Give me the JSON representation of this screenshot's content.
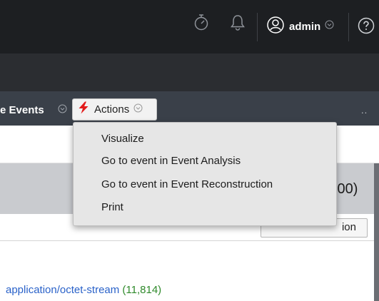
{
  "header": {
    "user_name": "admin",
    "icons": [
      "stopwatch-icon",
      "bell-icon",
      "user-icon",
      "chevron-down-icon",
      "help-icon"
    ]
  },
  "toolbar": {
    "title_fragment": "e Events",
    "actions_label": "Actions",
    "overflow": ".."
  },
  "actions_menu": {
    "items": [
      "Visualize",
      "Go to event in Event Analysis",
      "Go to event in Event Reconstruction",
      "Print"
    ]
  },
  "time_range_suffix": ":00)",
  "visualization_button": "ion",
  "content": {
    "mime_type": "application/octet-stream",
    "count": "(11,814)"
  },
  "colors": {
    "topbar": "#1d1f22",
    "toolbar": "#3a4049",
    "actions_icon": "#e21b1b",
    "link": "#2a62c9",
    "count": "#2f8a2b"
  }
}
